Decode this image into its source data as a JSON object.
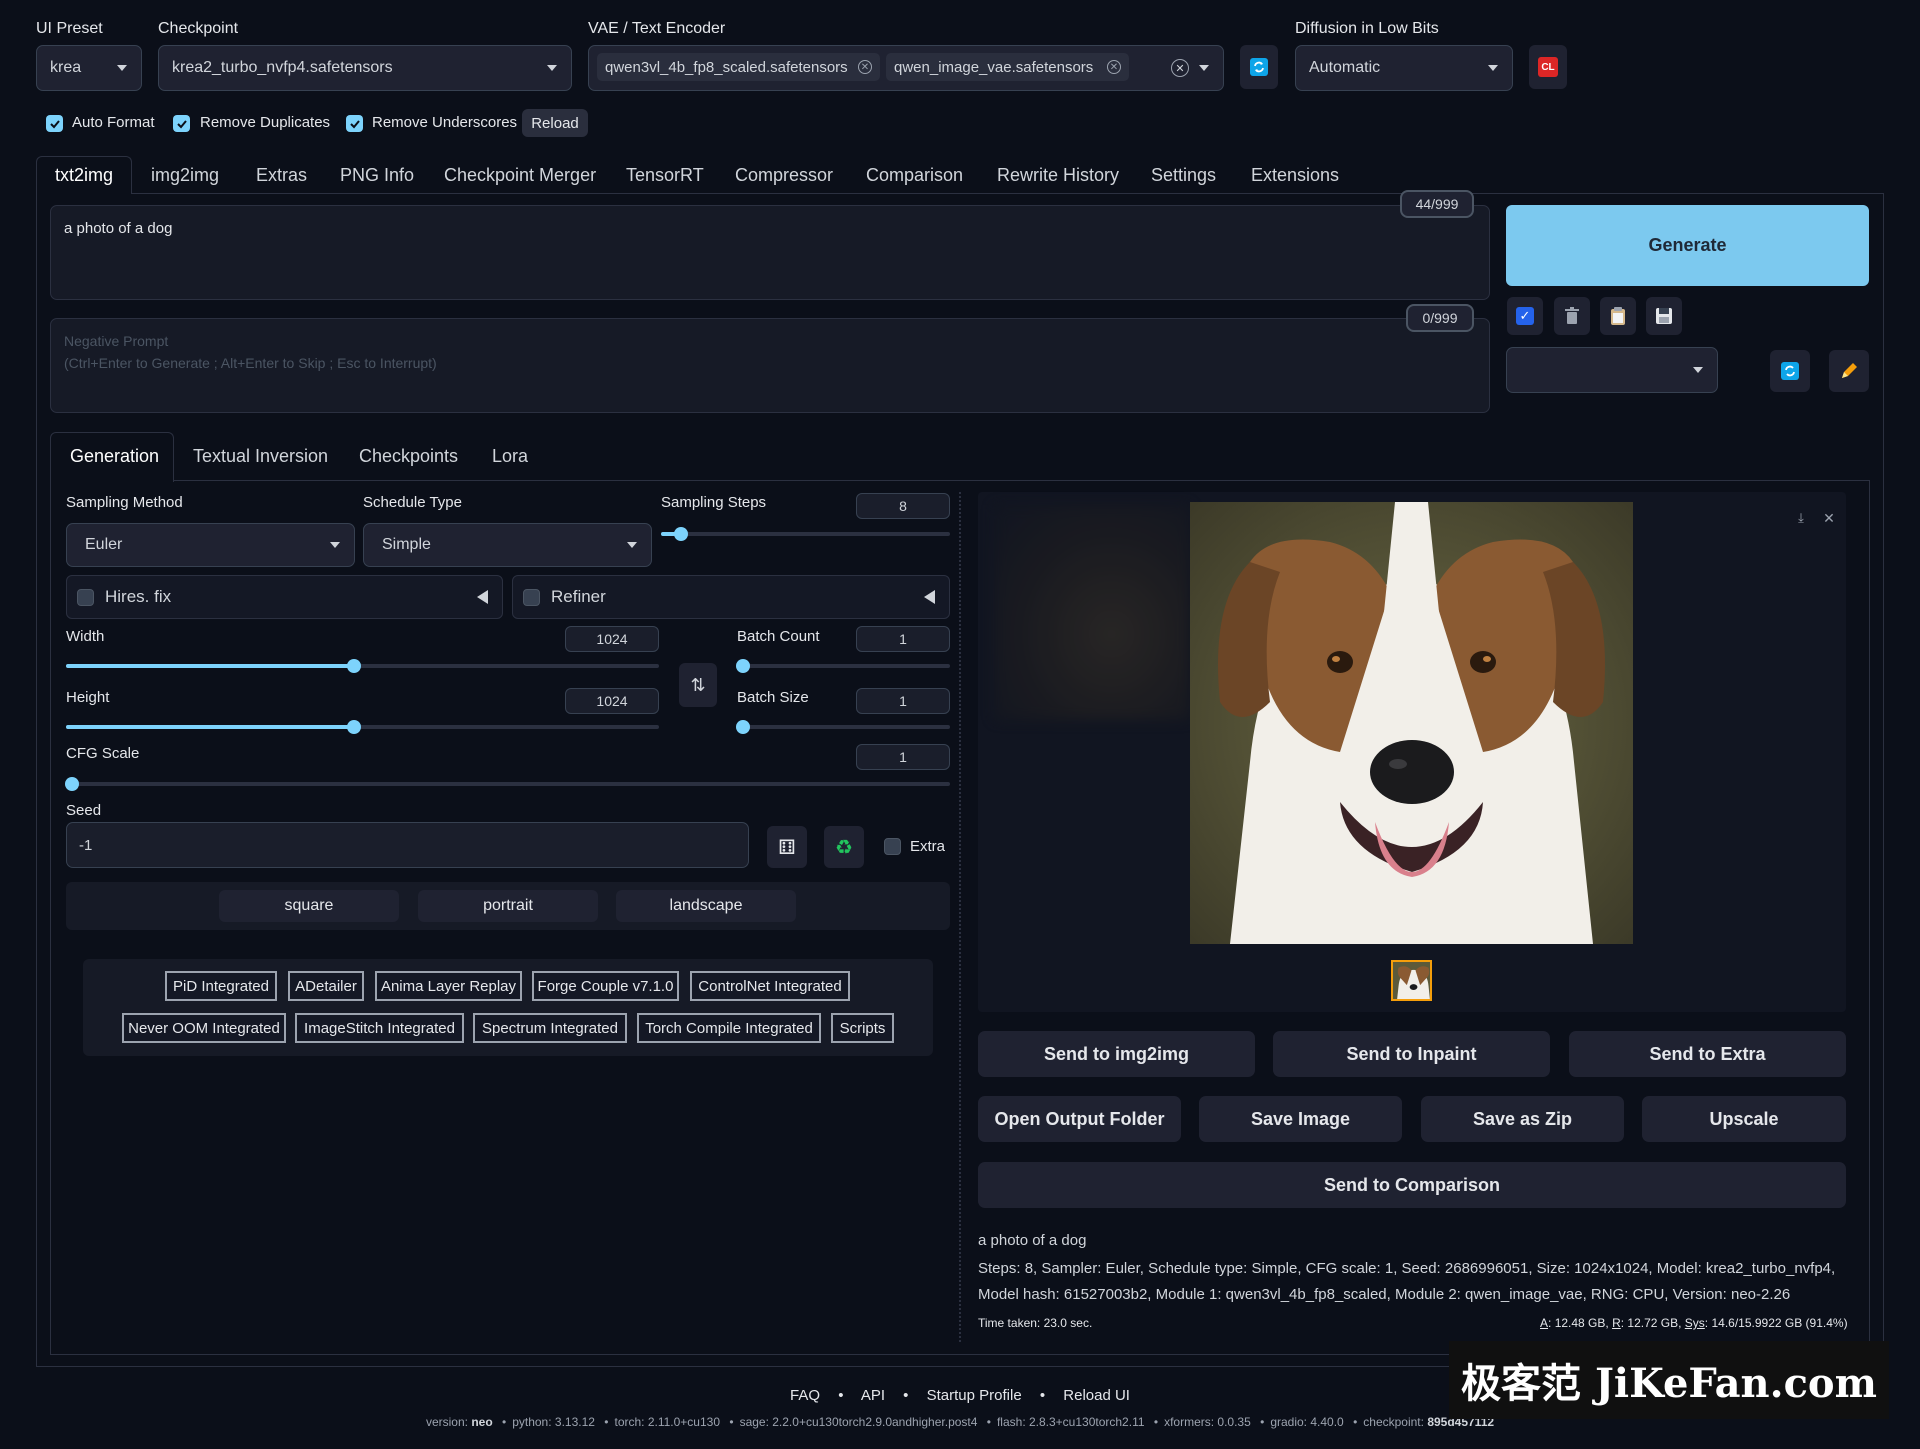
{
  "top": {
    "ui_preset": {
      "label": "UI Preset",
      "value": "krea"
    },
    "checkpoint": {
      "label": "Checkpoint",
      "value": "krea2_turbo_nvfp4.safetensors"
    },
    "vae": {
      "label": "VAE / Text Encoder",
      "chips": [
        "qwen3vl_4b_fp8_scaled.safetensors",
        "qwen_image_vae.safetensors"
      ]
    },
    "low_bits": {
      "label": "Diffusion in Low Bits",
      "value": "Automatic"
    },
    "cl_label": "CL"
  },
  "options": {
    "auto_format": "Auto Format",
    "remove_duplicates": "Remove Duplicates",
    "remove_underscores": "Remove Underscores",
    "reload": "Reload"
  },
  "tabs": [
    "txt2img",
    "img2img",
    "Extras",
    "PNG Info",
    "Checkpoint Merger",
    "TensorRT",
    "Compressor",
    "Comparison",
    "Rewrite History",
    "Settings",
    "Extensions"
  ],
  "prompt": {
    "text": "a photo of a dog",
    "counter": "44/999"
  },
  "negative": {
    "placeholder_line1": "Negative Prompt",
    "placeholder_line2": "(Ctrl+Enter to Generate ; Alt+Enter to Skip ; Esc to Interrupt)",
    "counter": "0/999"
  },
  "generate_label": "Generate",
  "subtabs": [
    "Generation",
    "Textual Inversion",
    "Checkpoints",
    "Lora"
  ],
  "gen": {
    "sampling_method": {
      "label": "Sampling Method",
      "value": "Euler"
    },
    "schedule_type": {
      "label": "Schedule Type",
      "value": "Simple"
    },
    "sampling_steps": {
      "label": "Sampling Steps",
      "value": "8",
      "fraction": 0.07
    },
    "hires": "Hires. fix",
    "refiner": "Refiner",
    "width": {
      "label": "Width",
      "value": "1024",
      "fraction": 0.485
    },
    "height": {
      "label": "Height",
      "value": "1024",
      "fraction": 0.485
    },
    "batch_count": {
      "label": "Batch Count",
      "value": "1",
      "fraction": 0.0
    },
    "batch_size": {
      "label": "Batch Size",
      "value": "1",
      "fraction": 0.0
    },
    "cfg": {
      "label": "CFG Scale",
      "value": "1",
      "fraction": 0.0
    },
    "seed": {
      "label": "Seed",
      "value": "-1",
      "extra": "Extra"
    },
    "aspect": [
      "square",
      "portrait",
      "landscape"
    ]
  },
  "extensions_row1": [
    "PiD Integrated",
    "ADetailer",
    "Anima Layer Replay",
    "Forge Couple v7.1.0",
    "ControlNet Integrated"
  ],
  "extensions_row2": [
    "Never OOM Integrated",
    "ImageStitch Integrated",
    "Spectrum Integrated",
    "Torch Compile Integrated",
    "Scripts"
  ],
  "output": {
    "buttons_row1": [
      "Send to img2img",
      "Send to Inpaint",
      "Send to Extra"
    ],
    "buttons_row2": [
      "Open Output Folder",
      "Save Image",
      "Save as Zip",
      "Upscale"
    ],
    "send_comparison": "Send to Comparison",
    "info_prompt": "a photo of a dog",
    "info_params": "Steps: 8, Sampler: Euler, Schedule type: Simple, CFG scale: 1, Seed: 2686996051, Size: 1024x1024, Model: krea2_turbo_nvfp4, Model hash: 61527003b2, Module 1: qwen3vl_4b_fp8_scaled, Module 2: qwen_image_vae, RNG: CPU, Version: neo-2.26",
    "time": "Time taken: 23.0 sec.",
    "mem_a_label": "A",
    "mem_a": "12.48 GB",
    "mem_r_label": "R",
    "mem_r": "12.72 GB",
    "mem_sys_label": "Sys",
    "mem_sys": "14.6/15.9922 GB (91.4%)"
  },
  "footer": {
    "links": [
      "FAQ",
      "API",
      "Startup Profile",
      "Reload UI"
    ],
    "version": "version: ",
    "version_val": "neo",
    "python": "python: 3.13.12",
    "torch": "torch: 2.11.0+cu130",
    "sage": "sage: 2.2.0+cu130torch2.9.0andhigher.post4",
    "flash": "flash: 2.8.3+cu130torch2.11",
    "xformers": "xformers: 0.0.35",
    "gradio": "gradio: 4.40.0",
    "checkpoint": "checkpoint: ",
    "checkpoint_val": "895d457112"
  },
  "watermark": "极客范 JiKeFan.com"
}
